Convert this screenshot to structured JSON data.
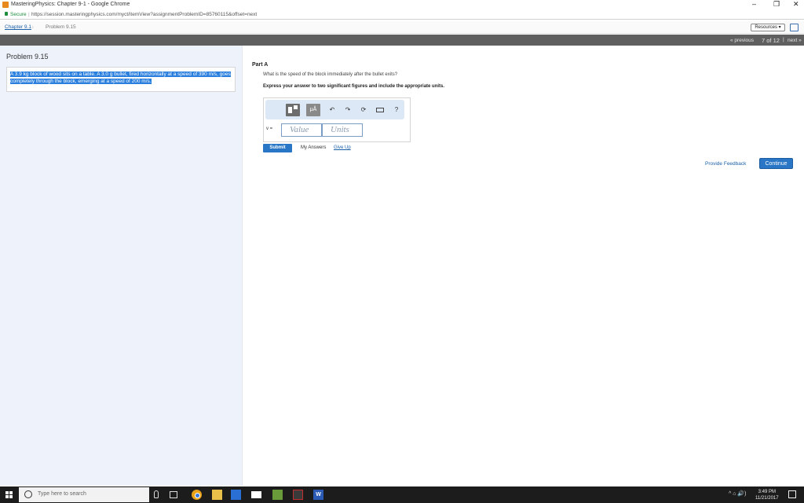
{
  "window": {
    "title": "MasteringPhysics: Chapter 9-1 - Google Chrome",
    "minimize": "–",
    "restore": "❐",
    "close": "✕"
  },
  "address_bar": {
    "secure_label": "Secure",
    "separator": "|",
    "url": "https://session.masteringphysics.com/myct/itemView?assignmentProblemID=85760115&offset=next"
  },
  "breadcrumb": {
    "chapter": "Chapter 9.1",
    "problem": "Problem 9.15",
    "resources_button": "Resources ▾"
  },
  "nav": {
    "previous": "« previous",
    "position": "7 of 12",
    "divider": "|",
    "next": "next »"
  },
  "problem": {
    "heading": "Problem 9.15",
    "text": "A 3.9 kg block of wood sits on a table. A 3.0 g bullet, fired horizontally at a speed of 390 m/s, goes completely through the block, emerging at a speed of 200 m/s."
  },
  "part": {
    "label": "Part A",
    "question": "What is the speed of the block immediately after the bullet exits?",
    "instruction": "Express your answer to two significant figures and include the appropriate units."
  },
  "answer": {
    "toolbar": {
      "mu_label": "μÅ",
      "undo": "↶",
      "redo": "↷",
      "reset": "⟳",
      "help": "?"
    },
    "variable_label": "v =",
    "value_placeholder": "Value",
    "units_placeholder": "Units"
  },
  "actions": {
    "submit": "Submit",
    "my_answers": "My Answers",
    "give_up": "Give Up",
    "provide_feedback": "Provide Feedback",
    "continue": "Continue"
  },
  "taskbar": {
    "search_placeholder": "Type here to search",
    "word_label": "W",
    "tray": "^  ⌂  🔊)",
    "time": "3:49 PM",
    "date": "11/21/2017"
  }
}
